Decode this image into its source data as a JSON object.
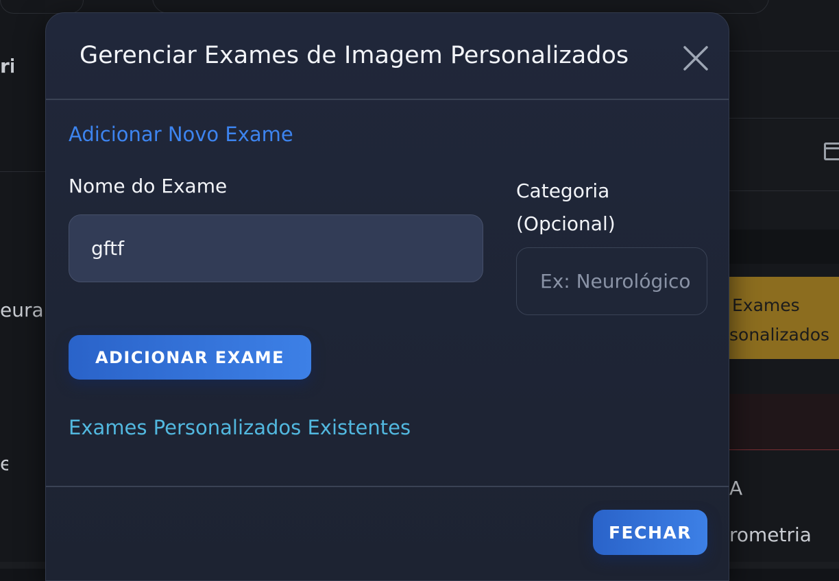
{
  "background": {
    "fragments": {
      "top_left": "ri",
      "mid_left": "eurai",
      "low_left": "e",
      "right_yellow_line1": "Exames",
      "right_yellow_line2": "sonalizados",
      "right_bottom_1": "A",
      "right_bottom_2": "rometria"
    }
  },
  "modal": {
    "title": "Gerenciar Exames de Imagem Personalizados",
    "close_icon": "close-icon",
    "add_section_title": "Adicionar Novo Exame",
    "name_label": "Nome do Exame",
    "name_value": "gftf",
    "category_label": "Categoria (Opcional)",
    "category_placeholder": "Ex: Neurológico",
    "add_button": "ADICIONAR EXAME",
    "existing_section_title": "Exames Personalizados Existentes",
    "close_button": "FECHAR"
  },
  "colors": {
    "accent": "#3d80e6",
    "section_add": "#3d84ef",
    "section_existing": "#52b8df",
    "warning_bg": "#8c6d1f"
  }
}
